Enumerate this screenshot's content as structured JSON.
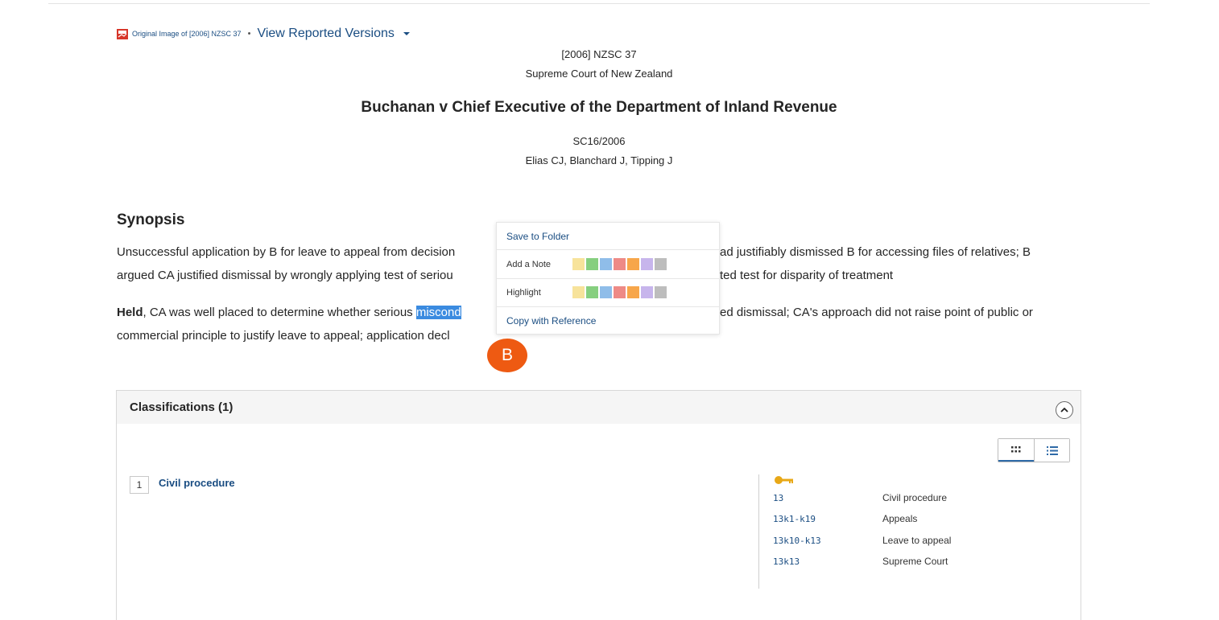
{
  "toolbar": {
    "original_image_label": "Original Image of [2006] NZSC 37",
    "separator": "•",
    "versions_label": "View Reported Versions"
  },
  "header": {
    "citation": "[2006] NZSC 37",
    "court": "Supreme Court of New Zealand",
    "title": "Buchanan v Chief Executive of the Department of Inland Revenue",
    "case_number": "SC16/2006",
    "judges": "Elias CJ, Blanchard J, Tipping J"
  },
  "synopsis": {
    "heading": "Synopsis",
    "line1_left": "Unsuccessful application by B for leave to appeal from decision",
    "line1_right": "ad justifiably dismissed B for accessing files of relatives; B",
    "line2_left": "argued CA justified dismissal by wrongly applying test of seriou",
    "line2_right": "ted test for disparity of treatment",
    "held_label": "Held",
    "line3_left": ", CA was well placed to determine whether serious ",
    "line3_selected": "miscond",
    "line3_right": "ed dismissal; CA's approach did not raise point of public or",
    "line4_left": "commercial principle to justify leave to appeal; application decl"
  },
  "popup": {
    "save_label": "Save to Folder",
    "note_label": "Add a Note",
    "highlight_label": "Highlight",
    "copy_label": "Copy with Reference",
    "swatch_colors": [
      "#f7e39b",
      "#86cf7f",
      "#8fbde9",
      "#ee8a86",
      "#f7a64a",
      "#c7b5ec",
      "#bdbdbd"
    ]
  },
  "badge": {
    "label": "B",
    "color": "#ee5a12"
  },
  "classifications": {
    "title": "Classifications (1)",
    "items": [
      {
        "num": "1",
        "name": "Civil procedure"
      }
    ],
    "keys": [
      {
        "code": "13",
        "desc": "Civil procedure"
      },
      {
        "code": "13k1-k19",
        "desc": "Appeals"
      },
      {
        "code": "13k10-k13",
        "desc": "Leave to appeal"
      },
      {
        "code": "13k13",
        "desc": "Supreme Court"
      }
    ]
  },
  "icons": {
    "pdf": "pdf-icon",
    "caret": "chevron-down-icon",
    "collapse": "chevron-up-icon",
    "grid_view": "grid-icon",
    "list_view": "list-icon",
    "key": "key-icon"
  }
}
